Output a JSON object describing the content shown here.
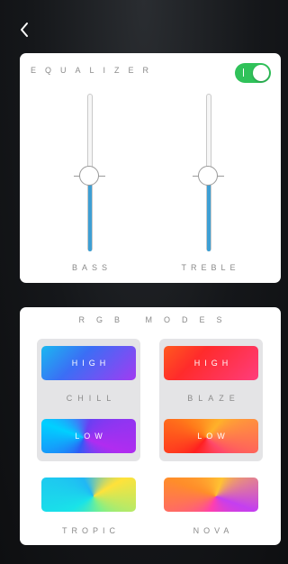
{
  "header": {
    "back_icon": "chevron-left-icon"
  },
  "equalizer": {
    "title": "EQUALIZER",
    "enabled": true,
    "sliders": [
      {
        "label": "BASS",
        "level": 0.48
      },
      {
        "label": "TREBLE",
        "level": 0.48
      }
    ]
  },
  "rgb_modes": {
    "title": "RGB MODES",
    "groups": [
      {
        "name": "CHILL",
        "high_label": "HIGH",
        "low_label": "LOW"
      },
      {
        "name": "BLAZE",
        "high_label": "HIGH",
        "low_label": "LOW"
      }
    ],
    "singles": [
      {
        "name": "TROPIC"
      },
      {
        "name": "NOVA"
      }
    ]
  },
  "colors": {
    "toggle_on": "#30c25a",
    "slider_fill": "#3d9fd4",
    "card_bg": "#ffffff",
    "label_gray": "#8a8a8a"
  }
}
